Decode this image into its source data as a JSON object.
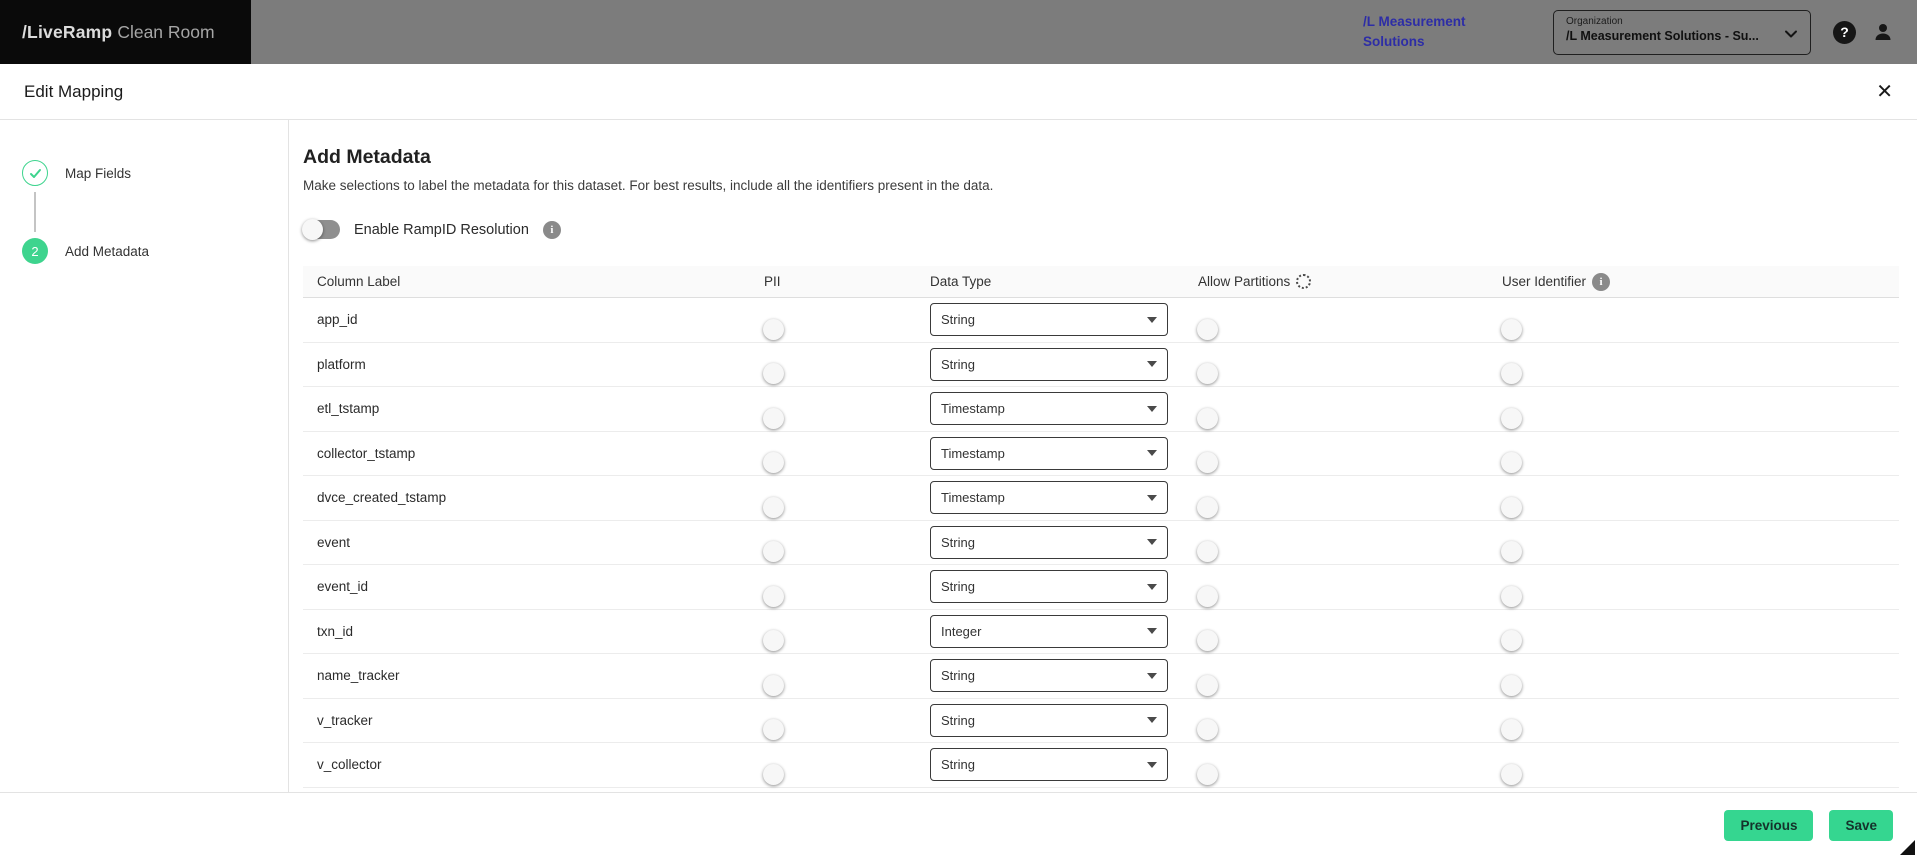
{
  "nav": {
    "brand_bold": "/LiveRamp",
    "brand_regular": "Clean Room",
    "account_name": "/L Measurement Solutions",
    "org_label": "Organization",
    "org_value": "/L Measurement Solutions - Su...",
    "help_glyph": "?"
  },
  "modal": {
    "title": "Edit Mapping",
    "close_glyph": "✕"
  },
  "steps": {
    "step1_label": "Map Fields",
    "step2_label": "Add Metadata",
    "step2_number": "2"
  },
  "content": {
    "heading": "Add Metadata",
    "description": "Make selections to label the metadata for this dataset. For best results, include all the identifiers present in the data.",
    "ramp_toggle_label": "Enable RampID Resolution",
    "info_glyph": "i"
  },
  "table": {
    "headers": [
      "Column Label",
      "PII",
      "Data Type",
      "Allow Partitions",
      "User Identifier"
    ],
    "rows": [
      {
        "label": "app_id",
        "pii": false,
        "data_type": "String",
        "allow_partitions": false,
        "user_identifier": false
      },
      {
        "label": "platform",
        "pii": false,
        "data_type": "String",
        "allow_partitions": false,
        "user_identifier": false
      },
      {
        "label": "etl_tstamp",
        "pii": false,
        "data_type": "Timestamp",
        "allow_partitions": false,
        "user_identifier": false
      },
      {
        "label": "collector_tstamp",
        "pii": false,
        "data_type": "Timestamp",
        "allow_partitions": false,
        "user_identifier": false
      },
      {
        "label": "dvce_created_tstamp",
        "pii": false,
        "data_type": "Timestamp",
        "allow_partitions": false,
        "user_identifier": false
      },
      {
        "label": "event",
        "pii": false,
        "data_type": "String",
        "allow_partitions": false,
        "user_identifier": false
      },
      {
        "label": "event_id",
        "pii": false,
        "data_type": "String",
        "allow_partitions": false,
        "user_identifier": false
      },
      {
        "label": "txn_id",
        "pii": false,
        "data_type": "Integer",
        "allow_partitions": false,
        "user_identifier": false
      },
      {
        "label": "name_tracker",
        "pii": false,
        "data_type": "String",
        "allow_partitions": false,
        "user_identifier": false
      },
      {
        "label": "v_tracker",
        "pii": false,
        "data_type": "String",
        "allow_partitions": false,
        "user_identifier": false
      },
      {
        "label": "v_collector",
        "pii": false,
        "data_type": "String",
        "allow_partitions": false,
        "user_identifier": false
      }
    ]
  },
  "footer": {
    "previous_label": "Previous",
    "save_label": "Save"
  },
  "colors": {
    "accent_green": "#35d690",
    "step_green": "#3ed48e",
    "link_blue": "#2d2da6",
    "nav_gray": "#7c7c7c"
  }
}
